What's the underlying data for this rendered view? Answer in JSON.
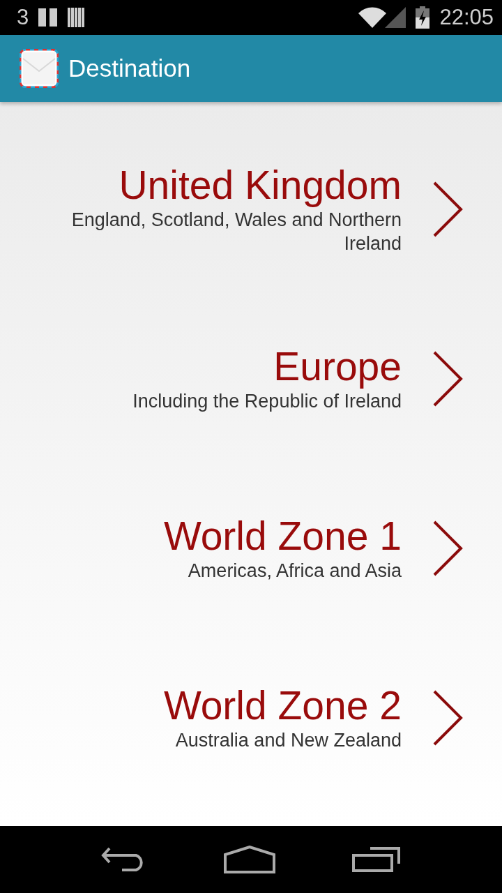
{
  "status_bar": {
    "notification": "3",
    "time": "22:05"
  },
  "app_bar": {
    "title": "Destination"
  },
  "destinations": [
    {
      "name": "United Kingdom",
      "description": "England, Scotland, Wales and Northern Ireland"
    },
    {
      "name": "Europe",
      "description": "Including the Republic of Ireland"
    },
    {
      "name": "World Zone 1",
      "description": "Americas, Africa and Asia"
    },
    {
      "name": "World Zone 2",
      "description": "Australia and New Zealand"
    }
  ]
}
